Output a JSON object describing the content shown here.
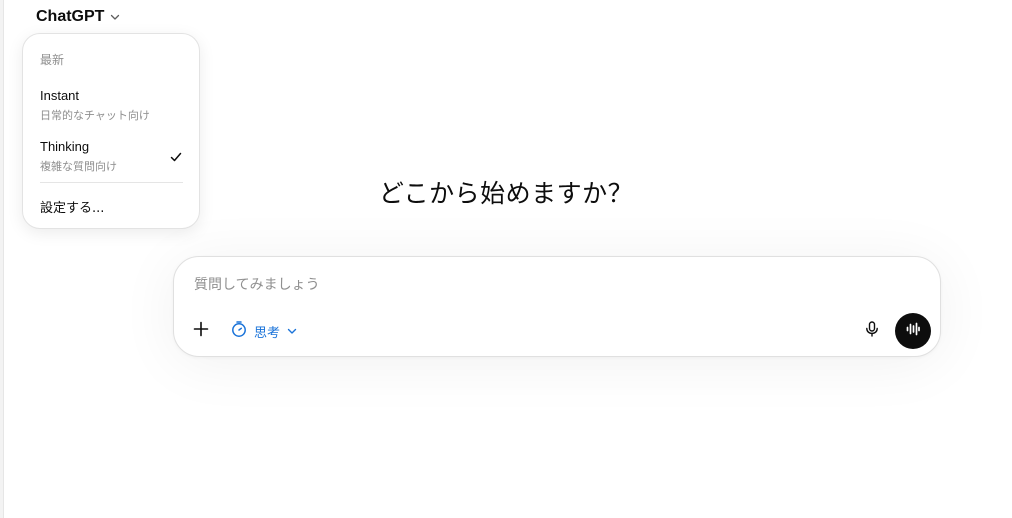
{
  "header": {
    "model_name": "ChatGPT",
    "chevron_icon": "chevron-down-icon"
  },
  "model_menu": {
    "section_label": "最新",
    "items": [
      {
        "title": "Instant",
        "subtitle": "日常的なチャット向け",
        "selected": false
      },
      {
        "title": "Thinking",
        "subtitle": "複雑な質問向け",
        "selected": true
      }
    ],
    "settings_label": "設定する..."
  },
  "main": {
    "headline": "どこから始めますか？"
  },
  "composer": {
    "placeholder": "質問してみましょう",
    "value": "",
    "mode_label": "思考",
    "mode_icon": "timer-icon",
    "attach_icon": "plus-icon",
    "mic_icon": "microphone-icon",
    "voice_icon": "voice-waveform-icon"
  },
  "colors": {
    "accent_blue": "#1a73d9",
    "text": "#0d0d0d",
    "muted": "#8f8f8f",
    "voice_button_bg": "#0d0d0d"
  }
}
